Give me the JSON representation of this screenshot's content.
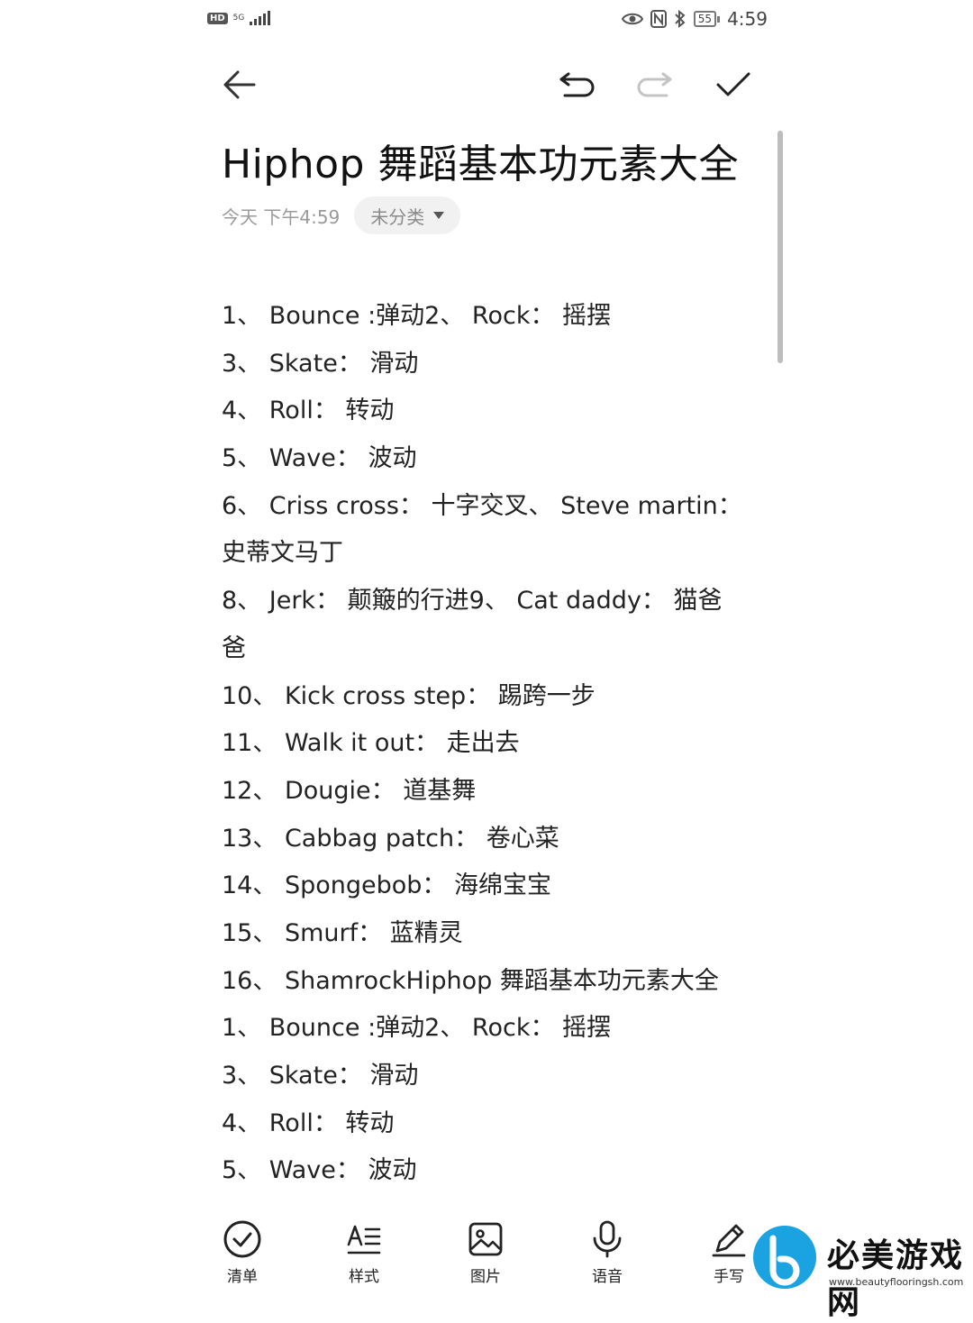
{
  "status_bar": {
    "hd": "HD",
    "network": "5G",
    "battery": "55",
    "time": "4:59"
  },
  "icons": {
    "back": "arrow-left-icon",
    "undo": "undo-icon",
    "redo": "redo-icon",
    "done": "checkmark-icon"
  },
  "note": {
    "title": "Hiphop 舞蹈基本功元素大全",
    "time": "今天 下午4:59",
    "category": "未分类",
    "lines": [
      "1、 Bounce :弹动2、 Rock： 摇摆",
      "3、 Skate： 滑动",
      "4、 Roll： 转动",
      "5、 Wave： 波动",
      "6、 Criss cross： 十字交叉、 Steve martin：",
      "史蒂文马丁",
      "8、 Jerk： 颠簸的行进9、 Cat daddy： 猫爸",
      "爸",
      "10、 Kick cross step： 踢跨一步",
      "11、 Walk it out： 走出去",
      "12、 Dougie： 道基舞",
      "13、 Cabbag patch： 卷心菜",
      "14、 Spongebob： 海绵宝宝",
      "15、 Smurf： 蓝精灵",
      "16、 ShamrockHiphop 舞蹈基本功元素大全",
      "1、 Bounce :弹动2、 Rock： 摇摆",
      "3、 Skate： 滑动",
      "4、 Roll： 转动",
      "5、 Wave： 波动"
    ]
  },
  "bottom_bar": {
    "checklist": "清单",
    "style": "样式",
    "image": "图片",
    "voice": "语音",
    "handwrite": "手写"
  },
  "watermark": {
    "text": "必美游戏网",
    "url": "www.beautyflooringsh.com"
  },
  "colors": {
    "text": "#222222",
    "muted": "#9a9a9a",
    "chip_bg": "#f1f1f1",
    "watermark_blue": "#1aa3e0"
  }
}
